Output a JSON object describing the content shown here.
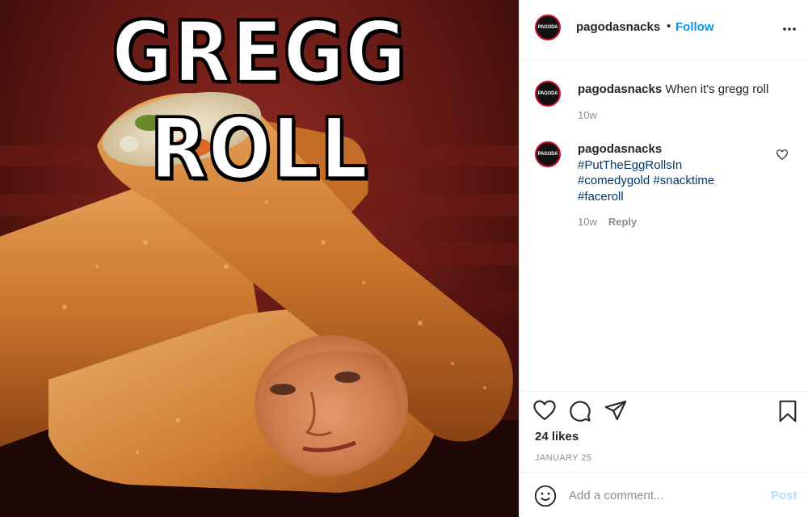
{
  "media": {
    "title_text": "GREGG ROLL"
  },
  "header": {
    "avatar_text": "PAGODA",
    "username": "pagodasnacks",
    "separator": "•",
    "follow_label": "Follow"
  },
  "caption": {
    "avatar_text": "PAGODA",
    "username": "pagodasnacks",
    "text": "When it's gregg roll",
    "time": "10w"
  },
  "comment": {
    "avatar_text": "PAGODA",
    "username": "pagodasnacks",
    "hashtags": [
      "#PutTheEggRollsIn",
      "#comedygold #snacktime",
      "#faceroll"
    ],
    "time": "10w",
    "reply_label": "Reply"
  },
  "actions": {
    "likes": "24 likes",
    "date": "JANUARY 25"
  },
  "add_comment": {
    "placeholder": "Add a comment...",
    "post_label": "Post"
  },
  "icons": {
    "more": "more-options-icon",
    "like": "heart-icon",
    "comment": "comment-bubble-icon",
    "share": "paper-plane-icon",
    "save": "bookmark-icon",
    "emoji": "emoji-icon"
  },
  "colors": {
    "accent": "#0095f6",
    "hashtag": "#00376b",
    "muted": "#8e8e8e",
    "post_disabled": "#b2dffc"
  }
}
